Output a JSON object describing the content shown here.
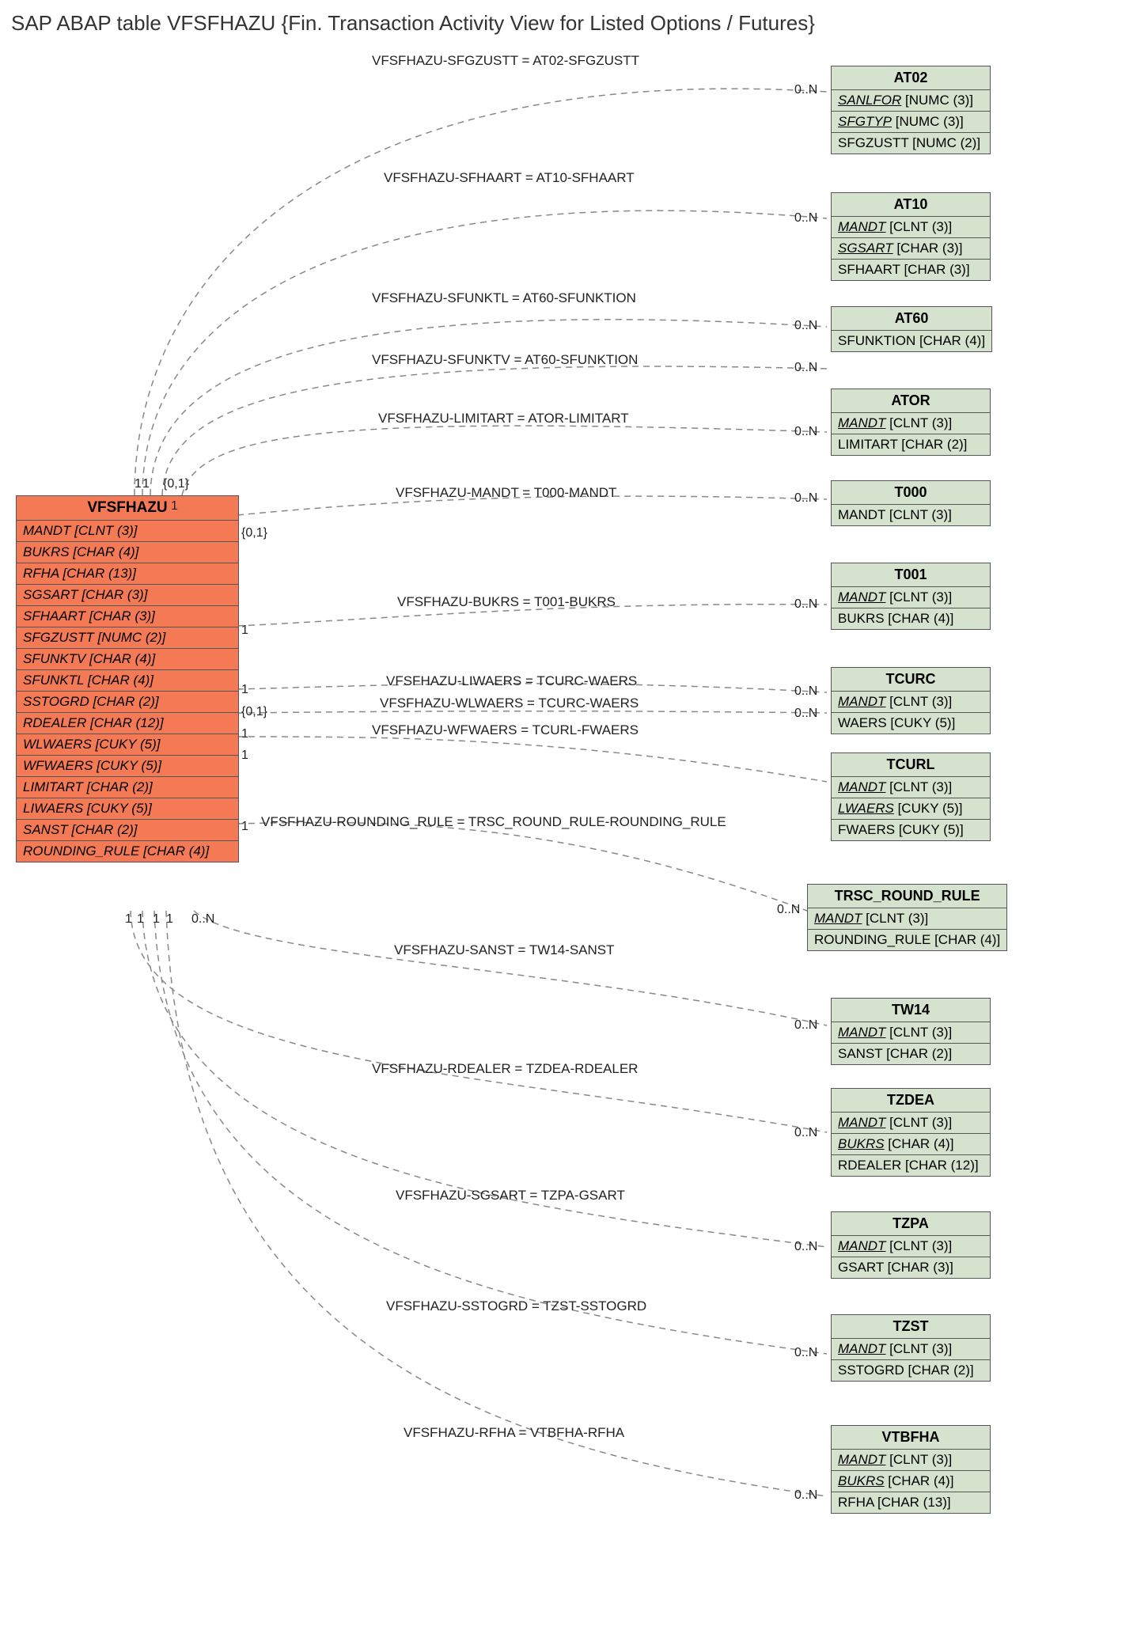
{
  "title": "SAP ABAP table VFSFHAZU {Fin. Transaction Activity View for Listed Options / Futures}",
  "main": {
    "name": "VFSFHAZU",
    "fields": [
      "MANDT [CLNT (3)]",
      "BUKRS [CHAR (4)]",
      "RFHA [CHAR (13)]",
      "SGSART [CHAR (3)]",
      "SFHAART [CHAR (3)]",
      "SFGZUSTT [NUMC (2)]",
      "SFUNKTV [CHAR (4)]",
      "SFUNKTL [CHAR (4)]",
      "SSTOGRD [CHAR (2)]",
      "RDEALER [CHAR (12)]",
      "WLWAERS [CUKY (5)]",
      "WFWAERS [CUKY (5)]",
      "LIMITART [CHAR (2)]",
      "LIWAERS [CUKY (5)]",
      "SANST [CHAR (2)]",
      "ROUNDING_RULE [CHAR (4)]"
    ]
  },
  "rels": [
    {
      "label": "VFSFHAZU-SFGZUSTT = AT02-SFGZUSTT",
      "rcard": "0..N",
      "lcard": "1"
    },
    {
      "label": "VFSFHAZU-SFHAART = AT10-SFHAART",
      "rcard": "0..N",
      "lcard": "{0,1}"
    },
    {
      "label": "VFSFHAZU-SFUNKTL = AT60-SFUNKTION",
      "rcard": "0..N",
      "lcard": "1"
    },
    {
      "label": "VFSFHAZU-SFUNKTV = AT60-SFUNKTION",
      "rcard": "0..N",
      "lcard": "1"
    },
    {
      "label": "VFSFHAZU-LIMITART = ATOR-LIMITART",
      "rcard": "0..N",
      "lcard": "{0,1}"
    },
    {
      "label": "VFSFHAZU-MANDT = T000-MANDT",
      "rcard": "0..N",
      "lcard": ""
    },
    {
      "label": "VFSFHAZU-BUKRS = T001-BUKRS",
      "rcard": "0..N",
      "lcard": "1"
    },
    {
      "label": "VFSFHAZU-LIWAERS = TCURC-WAERS",
      "rcard": "0..N",
      "lcard": "1"
    },
    {
      "label": "VFSFHAZU-WLWAERS = TCURC-WAERS",
      "rcard": "0..N",
      "lcard": "{0,1}"
    },
    {
      "label": "VFSFHAZU-WFWAERS = TCURL-FWAERS",
      "rcard": "",
      "lcard": "1"
    },
    {
      "label": "VFSFHAZU-ROUNDING_RULE = TRSC_ROUND_RULE-ROUNDING_RULE",
      "rcard": "0..N",
      "lcard": "1"
    },
    {
      "label": "VFSFHAZU-SANST = TW14-SANST",
      "rcard": "0..N",
      "lcard": "0..N"
    },
    {
      "label": "VFSFHAZU-RDEALER = TZDEA-RDEALER",
      "rcard": "0..N",
      "lcard": "1"
    },
    {
      "label": "VFSFHAZU-SGSART = TZPA-GSART",
      "rcard": "0..N",
      "lcard": "1"
    },
    {
      "label": "VFSFHAZU-SSTOGRD = TZST-SSTOGRD",
      "rcard": "0..N",
      "lcard": "1"
    },
    {
      "label": "VFSFHAZU-RFHA = VTBFHA-RFHA",
      "rcard": "0..N",
      "lcard": "1"
    }
  ],
  "right": [
    {
      "name": "AT02",
      "keys": [
        "SANLFOR [NUMC (3)]",
        "SFGTYP [NUMC (3)]"
      ],
      "fields": [
        "SFGZUSTT [NUMC (2)]"
      ]
    },
    {
      "name": "AT10",
      "keys": [
        "MANDT [CLNT (3)]",
        "SGSART [CHAR (3)]"
      ],
      "fields": [
        "SFHAART [CHAR (3)]"
      ]
    },
    {
      "name": "AT60",
      "keys": [],
      "fields": [
        "SFUNKTION [CHAR (4)]"
      ]
    },
    {
      "name": "ATOR",
      "keys": [
        "MANDT [CLNT (3)]"
      ],
      "fields": [
        "LIMITART [CHAR (2)]"
      ]
    },
    {
      "name": "T000",
      "keys": [],
      "fields": [
        "MANDT [CLNT (3)]"
      ]
    },
    {
      "name": "T001",
      "keys": [
        "MANDT [CLNT (3)]"
      ],
      "fields": [
        "BUKRS [CHAR (4)]"
      ]
    },
    {
      "name": "TCURC",
      "keys": [
        "MANDT [CLNT (3)]"
      ],
      "fields": [
        "WAERS [CUKY (5)]"
      ]
    },
    {
      "name": "TCURL",
      "keys": [
        "MANDT [CLNT (3)]",
        "LWAERS [CUKY (5)]"
      ],
      "fields": [
        "FWAERS [CUKY (5)]"
      ]
    },
    {
      "name": "TRSC_ROUND_RULE",
      "keys": [
        "MANDT [CLNT (3)]"
      ],
      "fields": [
        "ROUNDING_RULE [CHAR (4)]"
      ]
    },
    {
      "name": "TW14",
      "keys": [
        "MANDT [CLNT (3)]"
      ],
      "fields": [
        "SANST [CHAR (2)]"
      ]
    },
    {
      "name": "TZDEA",
      "keys": [
        "MANDT [CLNT (3)]",
        "BUKRS [CHAR (4)]"
      ],
      "fields": [
        "RDEALER [CHAR (12)]"
      ]
    },
    {
      "name": "TZPA",
      "keys": [
        "MANDT [CLNT (3)]"
      ],
      "fields": [
        "GSART [CHAR (3)]"
      ]
    },
    {
      "name": "TZST",
      "keys": [
        "MANDT [CLNT (3)]"
      ],
      "fields": [
        "SSTOGRD [CHAR (2)]"
      ]
    },
    {
      "name": "VTBFHA",
      "keys": [
        "MANDT [CLNT (3)]",
        "BUKRS [CHAR (4)]"
      ],
      "fields": [
        "RFHA [CHAR (13)]"
      ]
    }
  ],
  "bottom_lcards": [
    "1",
    "1",
    "1",
    "1"
  ]
}
